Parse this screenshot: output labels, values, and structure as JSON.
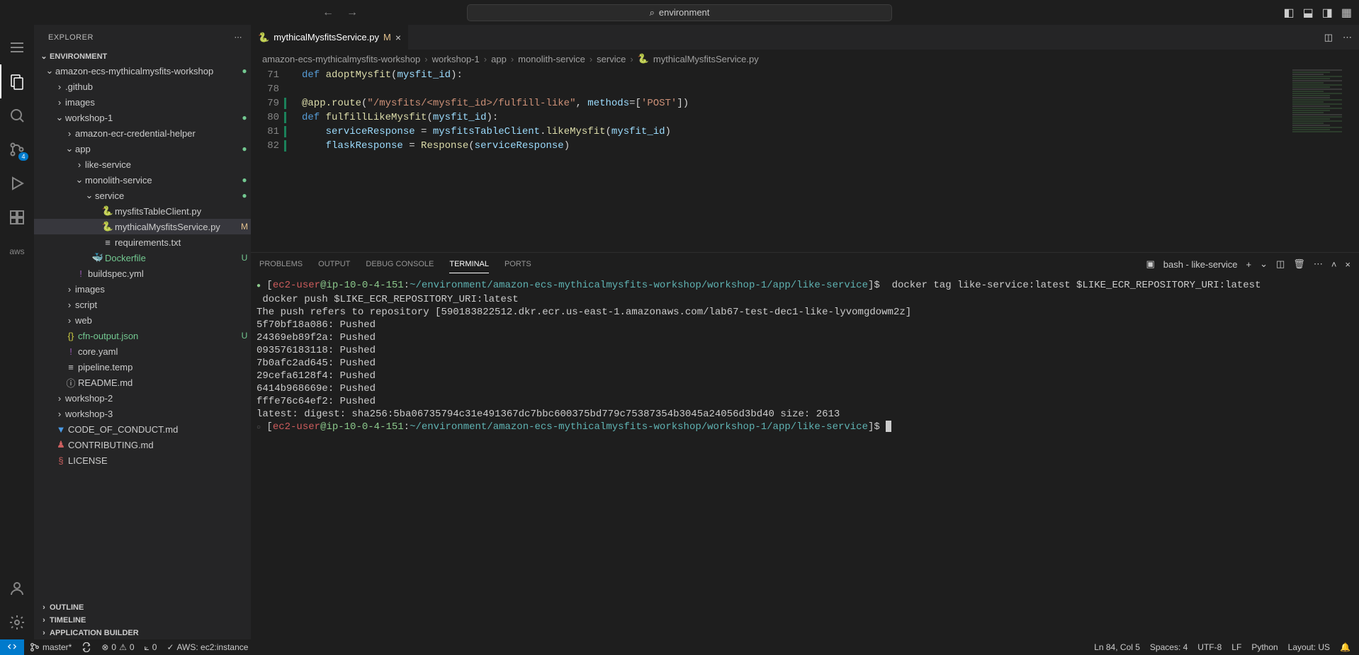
{
  "titlebar": {
    "search_text": "environment"
  },
  "sidebar": {
    "title": "EXPLORER",
    "workspace": "ENVIRONMENT",
    "sections": {
      "outline": "OUTLINE",
      "timeline": "TIMELINE",
      "app_builder": "APPLICATION BUILDER"
    },
    "tree": {
      "root": "amazon-ecs-mythicalmysfits-workshop",
      "github": ".github",
      "images": "images",
      "workshop1": "workshop-1",
      "ecr_helper": "amazon-ecr-credential-helper",
      "app": "app",
      "like_service": "like-service",
      "monolith_service": "monolith-service",
      "service": "service",
      "mysfits_table_client": "mysfitsTableClient.py",
      "mysfits_service": "mythicalMysfitsService.py",
      "requirements": "requirements.txt",
      "dockerfile": "Dockerfile",
      "buildspec": "buildspec.yml",
      "images2": "images",
      "script": "script",
      "web": "web",
      "cfn_output": "cfn-output.json",
      "core_yaml": "core.yaml",
      "pipeline_temp": "pipeline.temp",
      "readme": "README.md",
      "workshop2": "workshop-2",
      "workshop3": "workshop-3",
      "code_of_conduct": "CODE_OF_CONDUCT.md",
      "contributing": "CONTRIBUTING.md",
      "license": "LICENSE"
    },
    "status": {
      "modified": "M",
      "untracked": "U"
    }
  },
  "tabs": {
    "active": "mythicalMysfitsService.py",
    "status": "M"
  },
  "breadcrumbs": {
    "p1": "amazon-ecs-mythicalmysfits-workshop",
    "p2": "workshop-1",
    "p3": "app",
    "p4": "monolith-service",
    "p5": "service",
    "p6": "mythicalMysfitsService.py"
  },
  "editor": {
    "lines": {
      "l71": "71",
      "l78": "78",
      "l79": "79",
      "l80": "80",
      "l81": "81",
      "l82": "82"
    }
  },
  "panel": {
    "tabs": {
      "problems": "PROBLEMS",
      "output": "OUTPUT",
      "debug": "DEBUG CONSOLE",
      "terminal": "TERMINAL",
      "ports": "PORTS"
    },
    "shell_label": "bash - like-service"
  },
  "terminal": {
    "prompt_user": "ec2-user",
    "prompt_at": "@",
    "prompt_host": "ip-10-0-4-151",
    "prompt_colon": ":",
    "prompt_path": "~/environment/amazon-ecs-mythicalmysfits-workshop/workshop-1/app/like-service",
    "prompt_end": "$",
    "cmd1": "  docker tag like-service:latest $LIKE_ECR_REPOSITORY_URI:latest",
    "cmd2": " docker push $LIKE_ECR_REPOSITORY_URI:latest",
    "out1": "The push refers to repository [590183822512.dkr.ecr.us-east-1.amazonaws.com/lab67-test-dec1-like-lyvomgdowm2z]",
    "out2": "5f70bf18a086: Pushed",
    "out3": "24369eb89f2a: Pushed",
    "out4": "093576183118: Pushed",
    "out5": "7b0afc2ad645: Pushed",
    "out6": "29cefa6128f4: Pushed",
    "out7": "6414b968669e: Pushed",
    "out8": "fffe76c64ef2: Pushed",
    "out9": "latest: digest: sha256:5ba06735794c31e491367dc7bbc600375bd779c75387354b3045a24056d3bd40 size: 2613"
  },
  "statusbar": {
    "branch": "master*",
    "errors": "0",
    "warnings": "0",
    "ports": "0",
    "aws": "AWS: ec2:instance",
    "ln_col": "Ln 84, Col 5",
    "spaces": "Spaces: 4",
    "encoding": "UTF-8",
    "eol": "LF",
    "language": "Python",
    "layout": "Layout: US"
  },
  "activity": {
    "scm_badge": "4",
    "aws_label": "aws"
  }
}
